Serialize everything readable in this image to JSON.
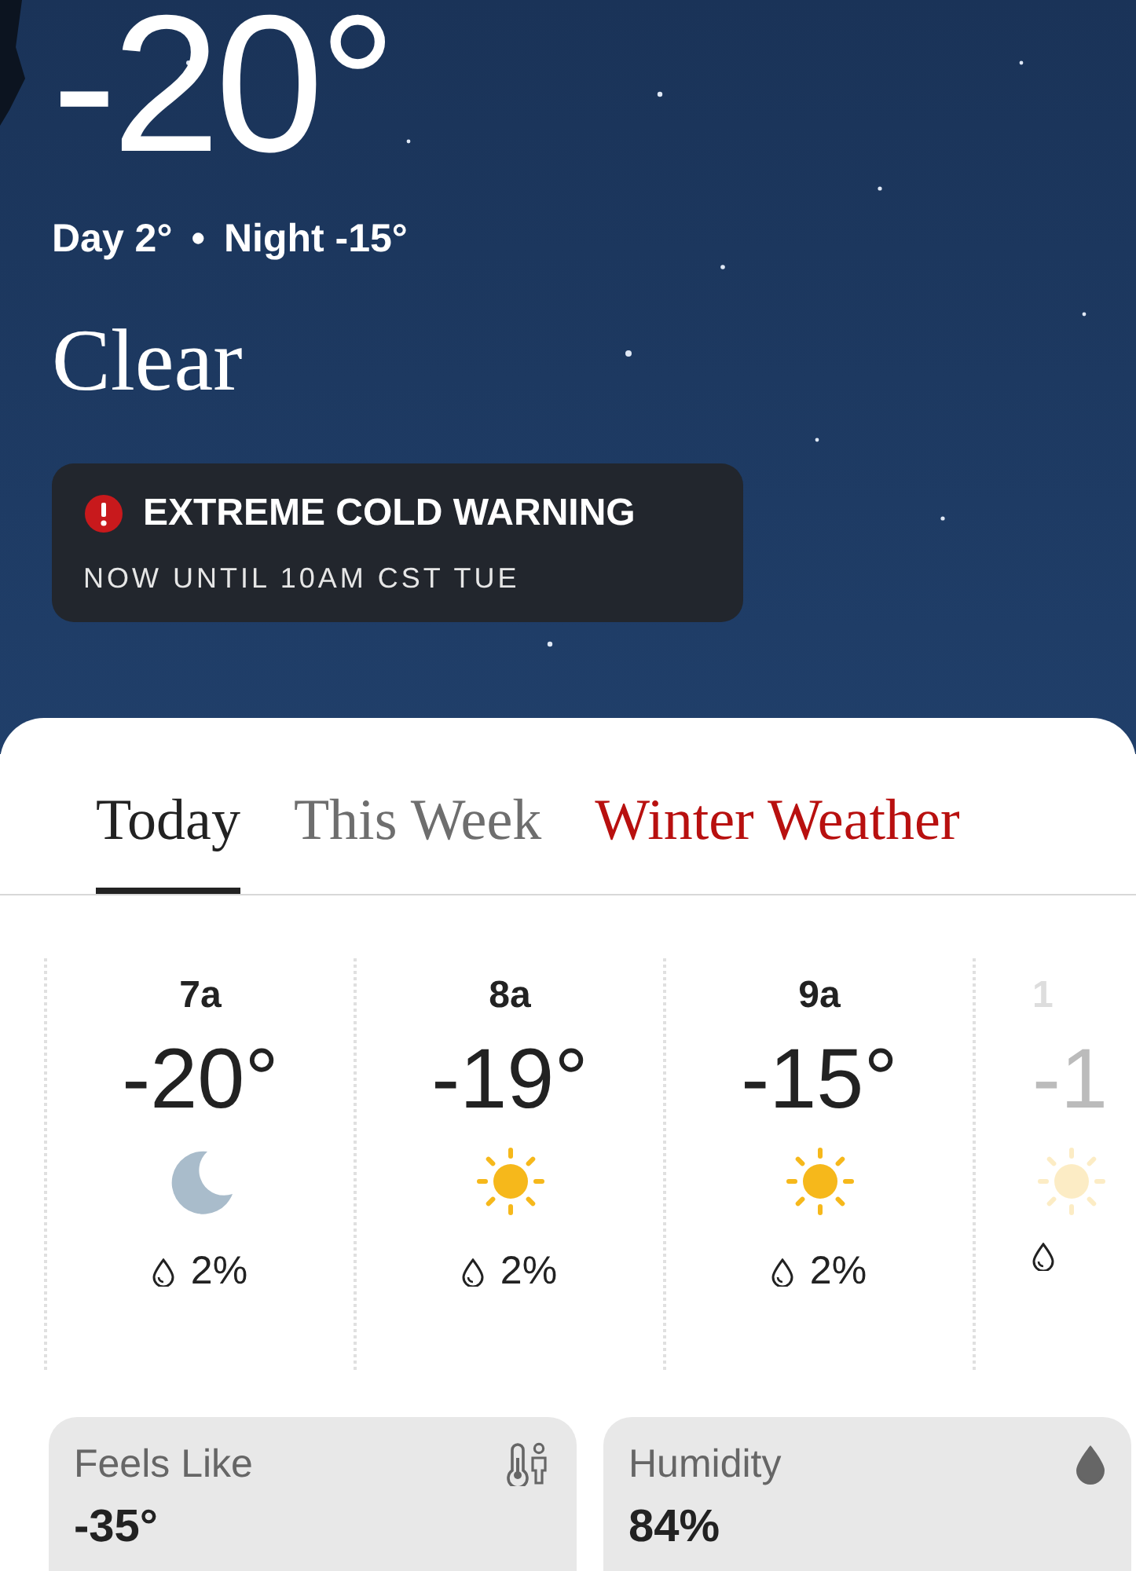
{
  "current": {
    "temperature": "-20°",
    "day": "Day 2°",
    "separator": "•",
    "night": "Night -15°",
    "condition": "Clear"
  },
  "alert": {
    "title": "EXTREME COLD WARNING",
    "subtitle": "NOW UNTIL 10AM CST TUE"
  },
  "tabs": [
    {
      "label": "Today",
      "selected": true,
      "kind": "normal"
    },
    {
      "label": "This Week",
      "selected": false,
      "kind": "normal"
    },
    {
      "label": "Winter Weather",
      "selected": false,
      "kind": "alert"
    }
  ],
  "hourly": [
    {
      "time": "7a",
      "temp": "-20°",
      "kind": "moon",
      "precip": "2%"
    },
    {
      "time": "8a",
      "temp": "-19°",
      "kind": "sun",
      "precip": "2%"
    },
    {
      "time": "9a",
      "temp": "-15°",
      "kind": "sun",
      "precip": "2%"
    },
    {
      "time": "1",
      "temp": "-1",
      "kind": "sun",
      "partial": true
    }
  ],
  "details": [
    {
      "label": "Feels Like",
      "value": "-35°",
      "kind": "thermometer-person"
    },
    {
      "label": "Humidity",
      "value": "84%",
      "kind": "drop"
    }
  ]
}
